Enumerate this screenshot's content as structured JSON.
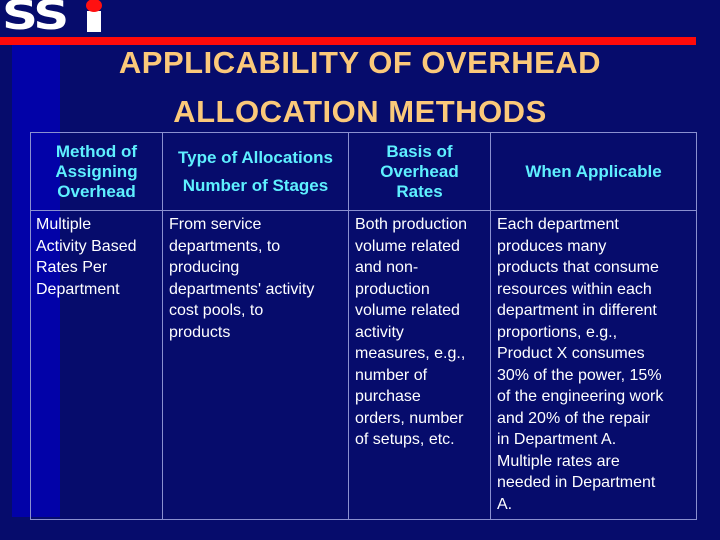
{
  "logo": {
    "text": "SS",
    "accent_color": "#ff1010",
    "name": "SSi"
  },
  "slide": {
    "title_line1": "APPLICABILITY OF OVERHEAD",
    "title_line2": "ALLOCATION METHODS",
    "colors": {
      "background": "#060c6c",
      "title": "#fbc97a",
      "header_text": "#5ef0ff",
      "body_text": "#ffffff",
      "rule": "#ff0a0a",
      "side_bar": "#0202a8",
      "grid_lines": "#8a90d0"
    }
  },
  "table": {
    "headers": [
      {
        "line1": "Method of\nAssigning\nOverhead",
        "line2": ""
      },
      {
        "line1": "Type of Allocations",
        "line2": "Number of Stages"
      },
      {
        "line1": "Basis of\nOverhead\nRates",
        "line2": ""
      },
      {
        "line1": "When Applicable",
        "line2": ""
      }
    ],
    "rows": [
      {
        "method": "Multiple\nActivity Based\nRates Per\nDepartment",
        "type": "From service\ndepartments, to\nproducing\ndepartments' activity\ncost pools, to\nproducts",
        "basis": "Both production\nvolume related\nand non-\nproduction\nvolume related\nactivity\nmeasures, e.g.,\nnumber of\npurchase\norders, number\nof setups, etc.",
        "when": "Each department\nproduces many\nproducts that consume\nresources within each\ndepartment in different\nproportions, e.g.,\nProduct X consumes\n30% of the power, 15%\nof the engineering work\nand 20% of the repair\nin Department A.\nMultiple rates are\nneeded in Department\nA."
      }
    ]
  }
}
